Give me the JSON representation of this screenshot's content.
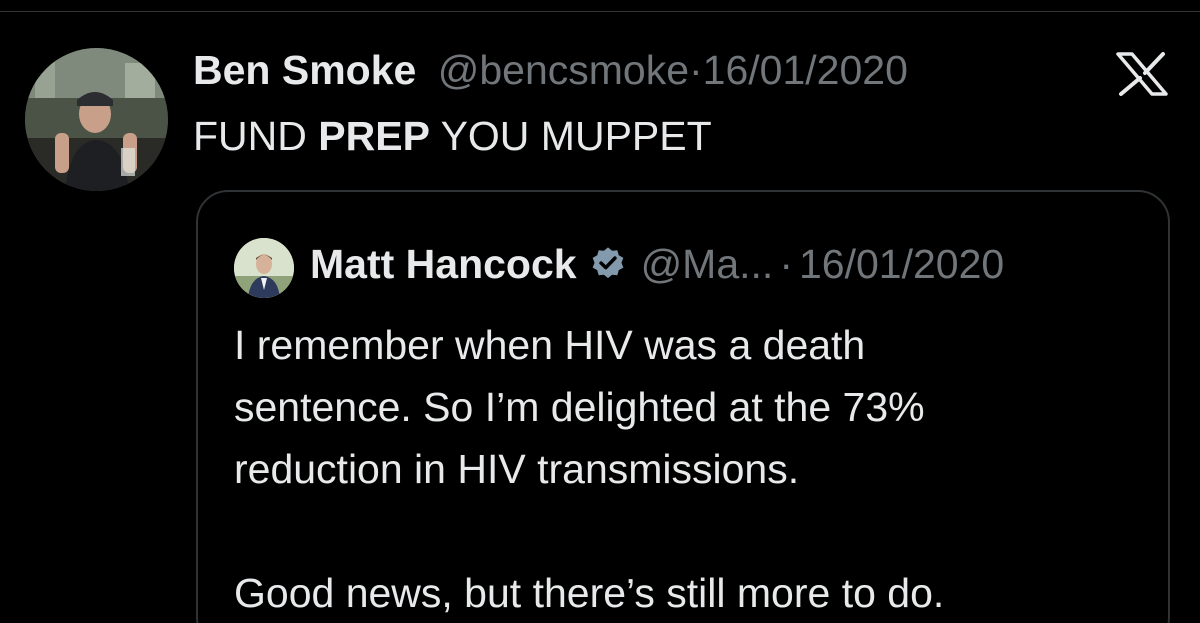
{
  "tweet": {
    "author_name": "Ben Smoke",
    "author_handle": "@bencsmoke",
    "separator": "·",
    "date": "16/01/2020",
    "text_before": "FUND ",
    "text_bold": "PREP",
    "text_after": " YOU MUPPET"
  },
  "quoted_tweet": {
    "author_name": "Matt Hancock",
    "author_handle": "@Ma...",
    "separator": "·",
    "date": "16/01/2020",
    "line_1": "I remember when HIV was a death",
    "line_2": "sentence. So I’m delighted at the 73%",
    "line_3": "reduction in HIV transmissions.",
    "line_4": "Good news, but there’s still more to do."
  },
  "icons": {
    "platform_logo": "x-logo-icon",
    "verified": "verified-badge-icon"
  },
  "colors": {
    "background": "#000000",
    "text_primary": "#e7e9ea",
    "text_secondary": "#71767b",
    "border": "#2f3336",
    "verified_badge": "#829aab"
  }
}
